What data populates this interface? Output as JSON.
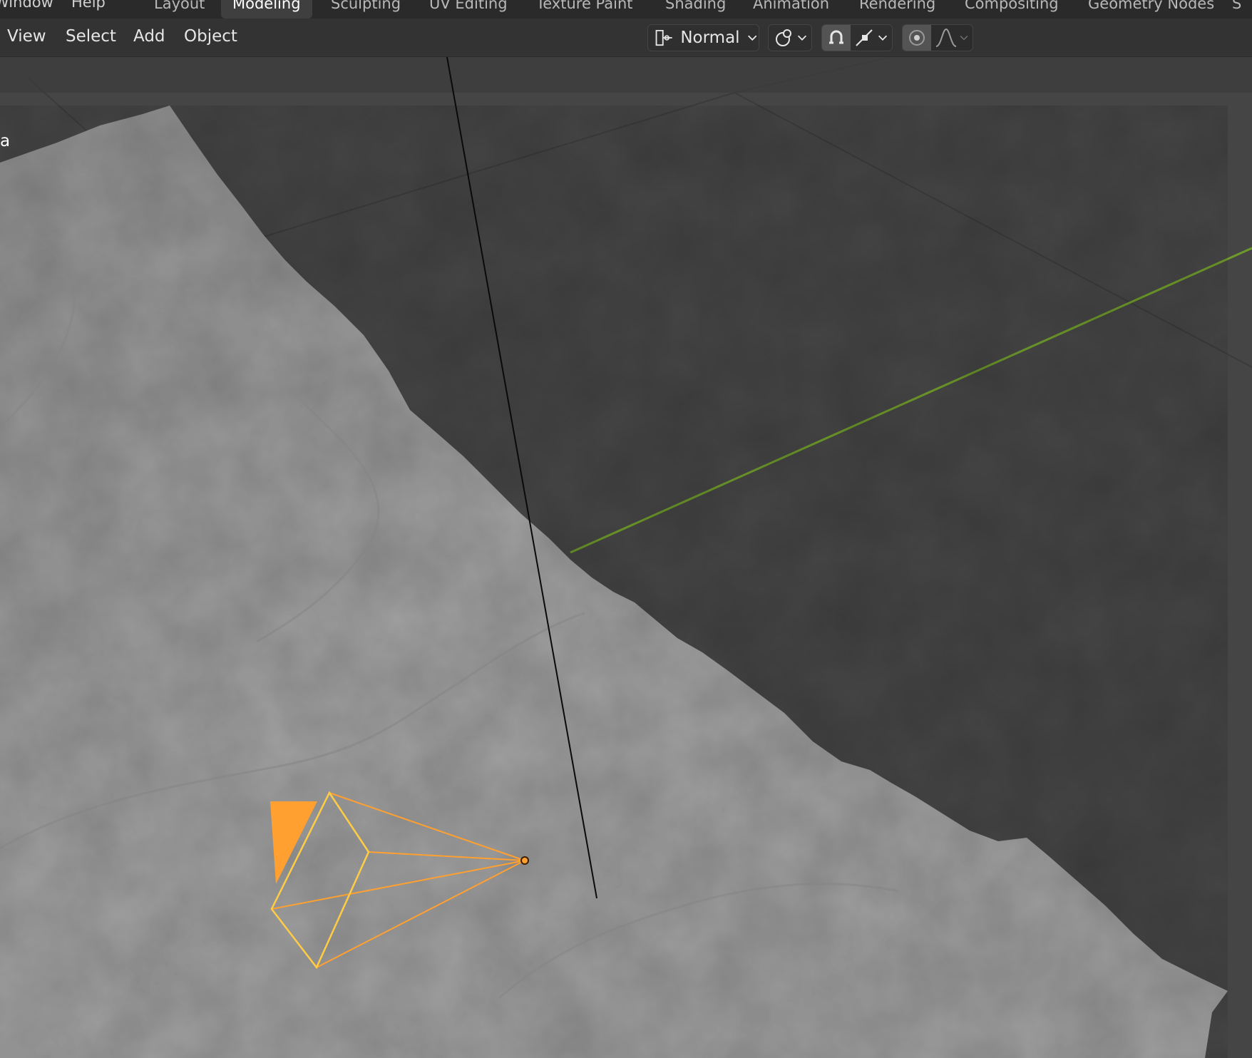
{
  "topbar": {
    "menus": [
      "Window",
      "Help"
    ],
    "workspace_tabs": [
      {
        "label": "Layout"
      },
      {
        "label": "Modeling",
        "active": true
      },
      {
        "label": "Sculpting"
      },
      {
        "label": "UV Editing"
      },
      {
        "label": "Texture Paint"
      },
      {
        "label": "Shading"
      },
      {
        "label": "Animation"
      },
      {
        "label": "Rendering"
      },
      {
        "label": "Compositing"
      },
      {
        "label": "Geometry Nodes"
      },
      {
        "label": "S"
      }
    ]
  },
  "viewport_header": {
    "menus": [
      "View",
      "Select",
      "Add",
      "Object"
    ],
    "orientation_label": "Normal",
    "icons": [
      "transform-orientation-icon",
      "pivot-icon",
      "snap-magnet-icon",
      "snap-target-icon",
      "proportional-edit-icon",
      "falloff-curve-icon"
    ]
  },
  "viewport": {
    "object_label": "a",
    "colors": {
      "background": "#454545",
      "terrain": "#9a9a9a",
      "y_axis": "#6e9a2a",
      "camera": "#ffa030",
      "camera_selected": "#ffcc44",
      "grid": "#3c3c3c"
    }
  }
}
